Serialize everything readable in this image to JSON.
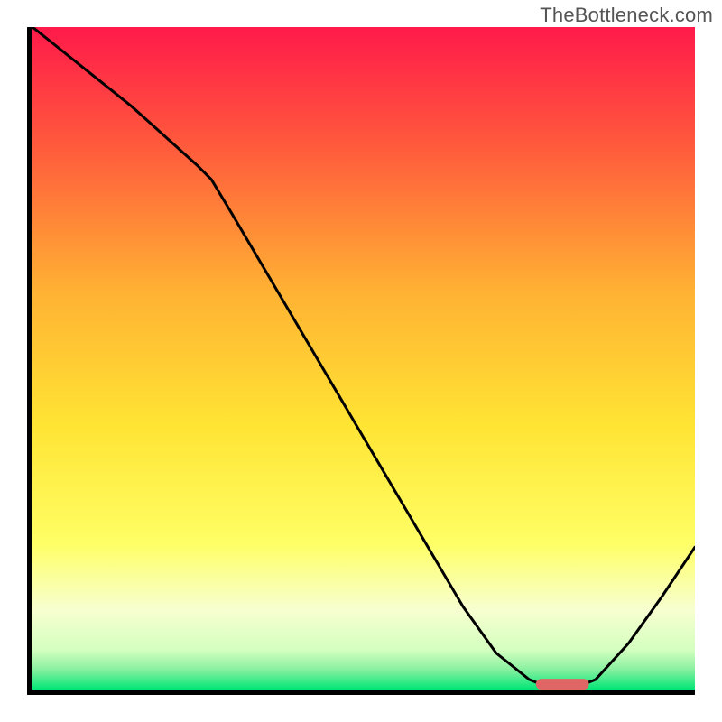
{
  "watermark": "TheBottleneck.com",
  "colors": {
    "gradient_top": "#ff1a4a",
    "gradient_mid_upper": "#ff7a33",
    "gradient_mid": "#ffd633",
    "gradient_lower_yellow": "#ffff66",
    "gradient_pale": "#f5ffdc",
    "gradient_green": "#00e676",
    "curve": "#000000",
    "marker": "#e06666",
    "axis": "#000000"
  },
  "chart_data": {
    "type": "line",
    "title": "",
    "xlabel": "",
    "ylabel": "",
    "xlim": [
      0,
      100
    ],
    "ylim": [
      0,
      100
    ],
    "grid": false,
    "legend": false,
    "x": [
      0,
      5,
      10,
      15,
      20,
      25,
      27,
      30,
      35,
      40,
      45,
      50,
      55,
      60,
      65,
      70,
      75,
      78,
      82,
      85,
      90,
      95,
      100
    ],
    "values": [
      100,
      96,
      92,
      88,
      83.5,
      79,
      77,
      72,
      63.5,
      55,
      46.5,
      38,
      29.5,
      21,
      12.5,
      5.5,
      1.5,
      0.3,
      0.3,
      1.5,
      7,
      14,
      21.5
    ],
    "flat_marker": {
      "x_start": 76,
      "x_end": 84,
      "y": 0.8
    },
    "gradient_stops_y_percent_from_top": [
      {
        "offset": 0,
        "color": "#ff1a4a"
      },
      {
        "offset": 18,
        "color": "#ff5a3c"
      },
      {
        "offset": 40,
        "color": "#ffb233"
      },
      {
        "offset": 60,
        "color": "#ffe433"
      },
      {
        "offset": 78,
        "color": "#ffff66"
      },
      {
        "offset": 88,
        "color": "#f7ffd0"
      },
      {
        "offset": 94,
        "color": "#d4ffc0"
      },
      {
        "offset": 97,
        "color": "#88f0a0"
      },
      {
        "offset": 100,
        "color": "#00e676"
      }
    ]
  }
}
